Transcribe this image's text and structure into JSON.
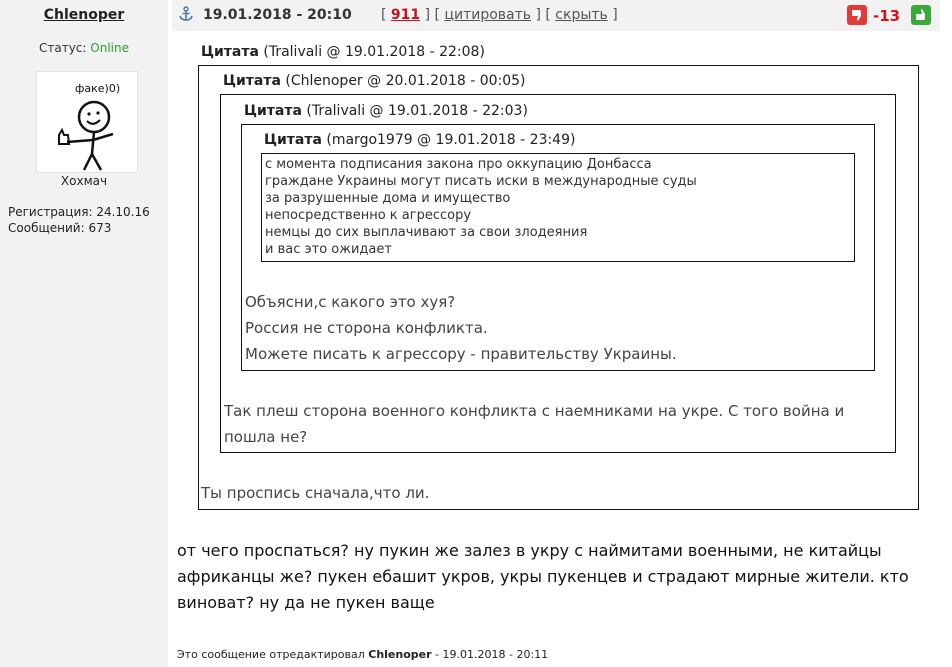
{
  "author": {
    "name": "Chlenoper",
    "status_label": "Статус:",
    "status_value": "Online",
    "avatar_text": "факе)0)",
    "avatar_caption": "Хохмач",
    "registration": "Регистрация: 24.10.16",
    "messages": "Сообщений: 673"
  },
  "post": {
    "date": "19.01.2018 - 20:10",
    "link_number": "911",
    "quote_label": "цитировать",
    "hide_label": "скрыть",
    "rating": "-13"
  },
  "quotes": [
    {
      "label": "Цитата",
      "meta": "(Tralivali @ 19.01.2018 - 22:08)",
      "text": "Ты проспись сначала,что ли."
    },
    {
      "label": "Цитата",
      "meta": "(Chlenoper @ 20.01.2018 - 00:05)",
      "text_lines": [
        "Так плеш сторона военного конфликта с наемниками на укре. С того война и",
        "пошла не?"
      ]
    },
    {
      "label": "Цитата",
      "meta": "(Tralivali @ 19.01.2018 - 22:03)",
      "text_lines": [
        "Объясни,с какого это хуя?",
        "Россия не сторона конфликта.",
        "Можете писать к агрессору - правительству Украины."
      ]
    },
    {
      "label": "Цитата",
      "meta": "(margo1979 @ 19.01.2018 - 23:49)",
      "text_lines": [
        "с момента подписания закона про оккупацию Донбасса",
        "граждане Украины могут писать иски в международные суды",
        "за разрушенные дома и имущество",
        "непосредственно к агрессору",
        "немцы до сих выплачивают за свои злодеяния",
        "и вас это ожидает"
      ]
    }
  ],
  "body_lines": [
    "от чего проспаться? ну пукин же залез в укру с наймитами военными, не китайцы",
    "африканцы же? пукен ебашит укров, укры пукенцев и страдают мирные жители. кто",
    "виноват? ну да не пукен ваще"
  ],
  "edited": {
    "prefix": "Это сообщение отредактировал",
    "user": "Chlenoper",
    "suffix": "- 19.01.2018 - 20:11"
  },
  "colors": {
    "online": "#2e9a2e",
    "rating": "#d0141c",
    "link_number": "#c0141c"
  },
  "icons": {
    "anchor": "anchor-icon",
    "thumb_down": "thumb-down-icon",
    "thumb_up": "thumb-up-icon"
  }
}
